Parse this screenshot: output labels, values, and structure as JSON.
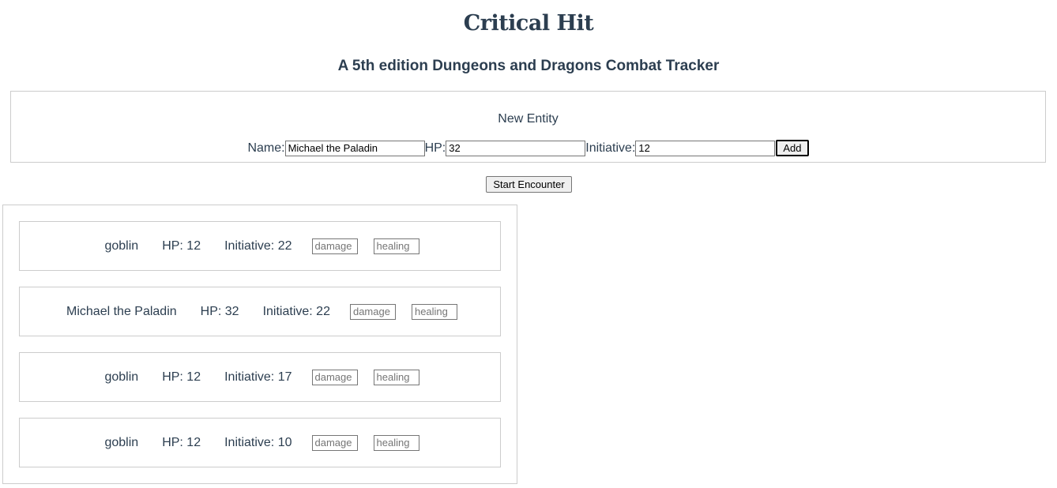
{
  "header": {
    "title": "Critical Hit",
    "subtitle": "A 5th edition Dungeons and Dragons Combat Tracker"
  },
  "new_entity": {
    "heading": "New Entity",
    "name_label": "Name:",
    "name_value": "Michael the Paladin",
    "hp_label": "HP:",
    "hp_value": "32",
    "initiative_label": "Initiative:",
    "initiative_value": "12",
    "add_label": "Add"
  },
  "start_encounter_label": "Start Encounter",
  "entities": [
    {
      "name": "goblin",
      "hp": "HP: 12",
      "initiative": "Initiative: 22",
      "damage_placeholder": "damage",
      "healing_placeholder": "healing"
    },
    {
      "name": "Michael the Paladin",
      "hp": "HP: 32",
      "initiative": "Initiative: 22",
      "damage_placeholder": "damage",
      "healing_placeholder": "healing"
    },
    {
      "name": "goblin",
      "hp": "HP: 12",
      "initiative": "Initiative: 17",
      "damage_placeholder": "damage",
      "healing_placeholder": "healing"
    },
    {
      "name": "goblin",
      "hp": "HP: 12",
      "initiative": "Initiative: 10",
      "damage_placeholder": "damage",
      "healing_placeholder": "healing"
    }
  ]
}
